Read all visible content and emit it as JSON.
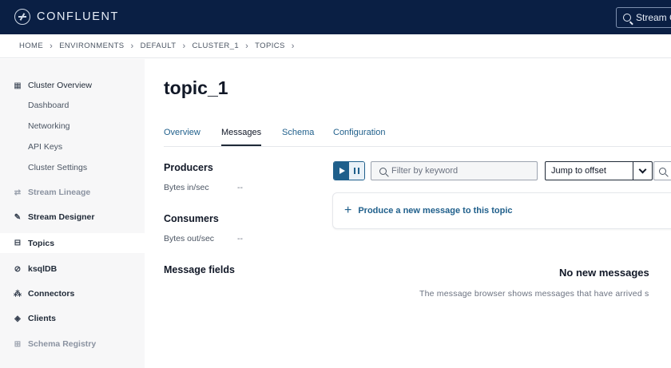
{
  "brand": {
    "name": "CONFLUENT"
  },
  "top_search": {
    "label": "Stream G"
  },
  "breadcrumb": [
    "HOME",
    "ENVIRONMENTS",
    "DEFAULT",
    "CLUSTER_1",
    "TOPICS"
  ],
  "sidebar": {
    "cluster_overview": "Cluster Overview",
    "sub_items": [
      "Dashboard",
      "Networking",
      "API Keys",
      "Cluster Settings"
    ],
    "stream_lineage": "Stream Lineage",
    "stream_designer": "Stream Designer",
    "topics": "Topics",
    "ksqldb": "ksqlDB",
    "connectors": "Connectors",
    "clients": "Clients",
    "schema_registry": "Schema Registry"
  },
  "page": {
    "title": "topic_1"
  },
  "tabs": [
    "Overview",
    "Messages",
    "Schema",
    "Configuration"
  ],
  "active_tab": "Messages",
  "producers": {
    "heading": "Producers",
    "label": "Bytes in/sec",
    "value": "--"
  },
  "consumers": {
    "heading": "Consumers",
    "label": "Bytes out/sec",
    "value": "--"
  },
  "message_fields": {
    "heading": "Message fields"
  },
  "controls": {
    "filter_placeholder": "Filter by keyword",
    "offset_value": "Jump to offset"
  },
  "produce": {
    "label": "Produce a new message to this topic"
  },
  "empty": {
    "heading": "No new messages",
    "text": "The message browser shows messages that have arrived s"
  },
  "colors": {
    "topbar": "#0a1f44",
    "link": "#1f5f8b",
    "sidebar_bg": "#f7f7f8"
  },
  "icons": {
    "cluster_overview": "grid-icon",
    "stream_lineage": "lineage-icon",
    "stream_designer": "designer-icon",
    "topics": "topic-icon",
    "ksqldb": "ksqldb-icon",
    "connectors": "connectors-icon",
    "clients": "clients-icon",
    "schema_registry": "schema-icon"
  }
}
